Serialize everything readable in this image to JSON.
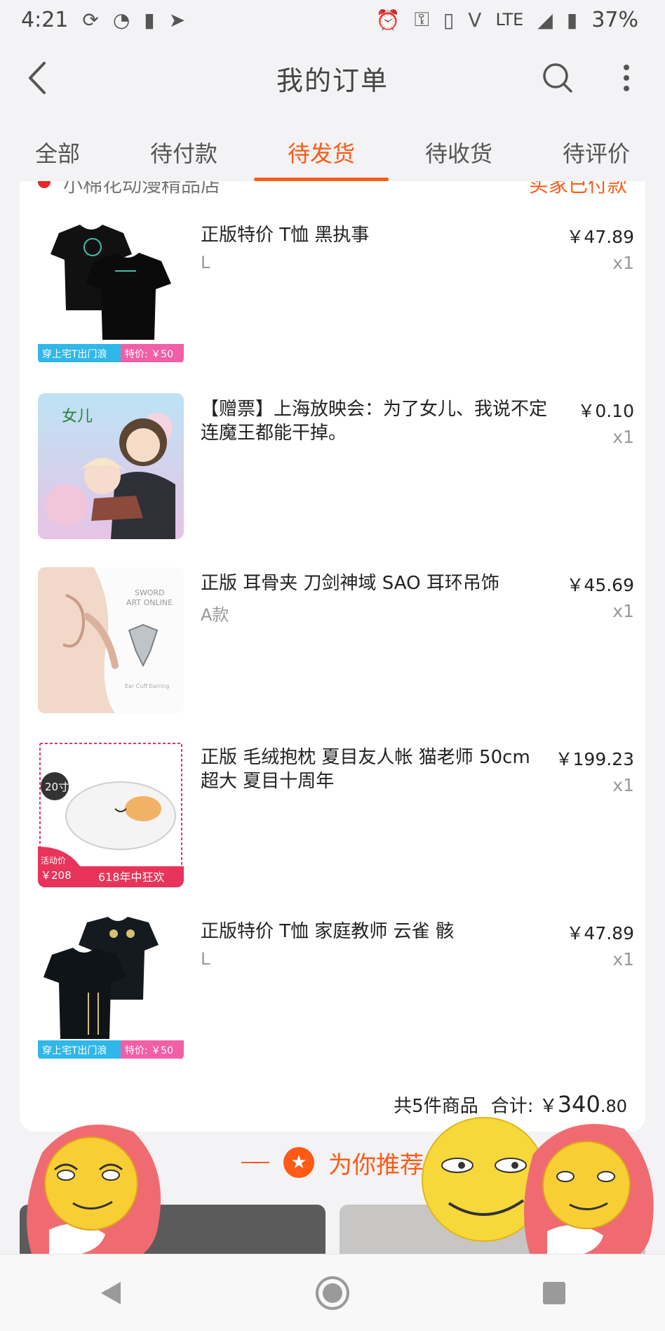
{
  "status_bar": {
    "time": "4:21",
    "network": "LTE",
    "battery": "37%"
  },
  "header": {
    "title": "我的订单"
  },
  "tabs": [
    {
      "label": "全部"
    },
    {
      "label": "待付款"
    },
    {
      "label": "待发货"
    },
    {
      "label": "待收货"
    },
    {
      "label": "待评价"
    }
  ],
  "active_tab": "待发货",
  "order": {
    "shop_name": "小棉花动漫精品店",
    "status": "买家已付款",
    "items": [
      {
        "title": "正版特价 T恤 黑执事",
        "spec": "L",
        "price": "￥47.89",
        "qty": "x1",
        "thumb_text": [
          "穿上宅T出门浪",
          "特价: ￥50"
        ]
      },
      {
        "title": "【赠票】上海放映会：为了女儿、我说不定连魔王都能干掉。",
        "spec": "",
        "price": "￥0.10",
        "qty": "x1",
        "thumb_text": [
          "女儿"
        ]
      },
      {
        "title": "正版  耳骨夹 刀剑神域 SAO 耳环吊饰",
        "spec": "A款",
        "price": "￥45.69",
        "qty": "x1",
        "thumb_text": [
          "SWORD",
          "ART ONLINE",
          "Ear Cuff Earring"
        ]
      },
      {
        "title": "正版 毛绒抱枕 夏目友人帐 猫老师 50cm 超大 夏目十周年",
        "spec": "",
        "price": "￥199.23",
        "qty": "x1",
        "thumb_text": [
          "20寸",
          "活动价",
          "￥208",
          "618年中狂欢"
        ]
      },
      {
        "title": "正版特价 T恤 家庭教师  云雀 骸",
        "spec": "L",
        "price": "￥47.89",
        "qty": "x1",
        "thumb_text": [
          "穿上宅T出门浪",
          "特价: ￥50"
        ]
      }
    ],
    "summary": {
      "count_text": "共5件商品",
      "total_label": "合计: ￥",
      "total_int": "340",
      "total_dec": ".80"
    }
  },
  "recommend": {
    "title": "为你推荐"
  },
  "colors": {
    "accent": "#ff5a16",
    "background": "#f3f2f4"
  }
}
